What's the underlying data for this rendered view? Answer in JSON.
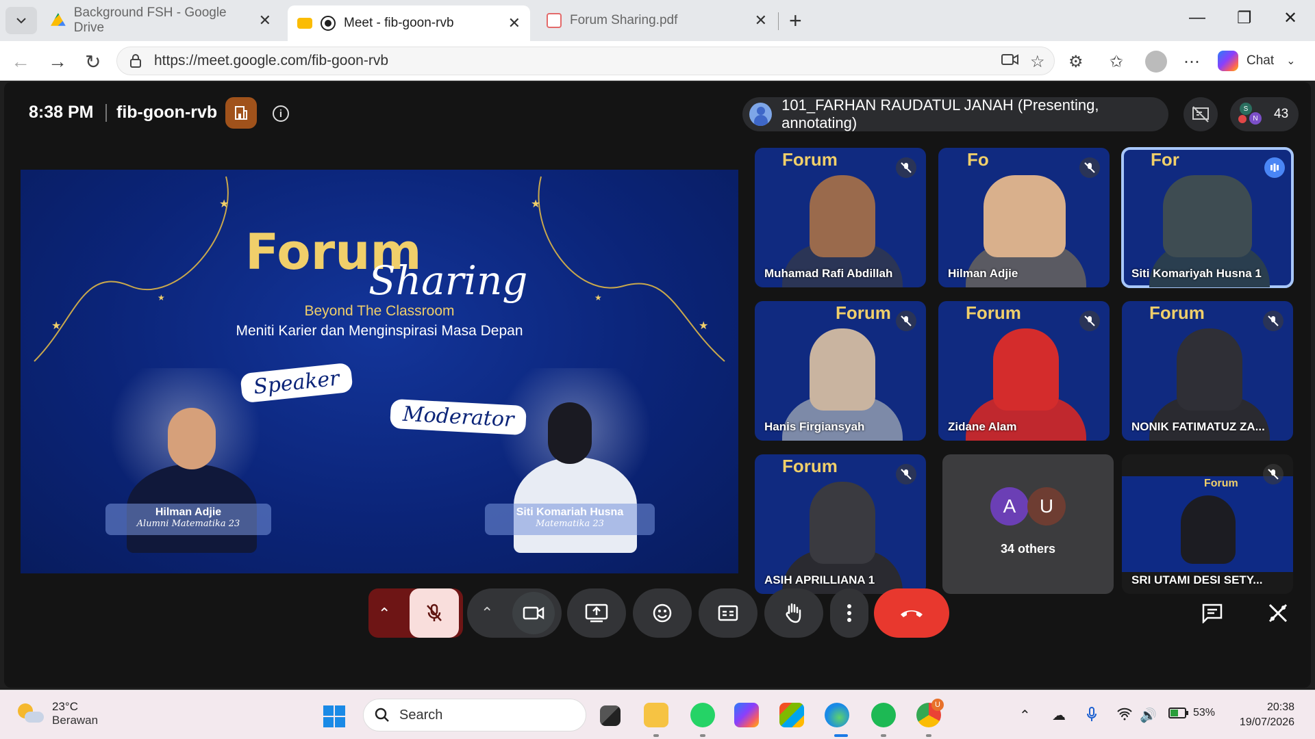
{
  "browser": {
    "tabs": [
      {
        "title": "Background FSH - Google Drive"
      },
      {
        "title": "Meet - fib-goon-rvb"
      },
      {
        "title": "Forum Sharing.pdf"
      }
    ],
    "url": "https://meet.google.com/fib-goon-rvb",
    "chat_label": "Chat"
  },
  "meet": {
    "time": "8:38 PM",
    "code": "fib-goon-rvb",
    "presenter": "101_FARHAN RAUDATUL JANAH (Presenting, annotating)",
    "participant_count": "43",
    "people_avatars": [
      "S",
      "N"
    ],
    "slide": {
      "title_word1": "Forum",
      "title_word2": "Sharing",
      "subtitle": "Beyond The Classroom",
      "tagline": "Meniti Karier dan Menginspirasi Masa Depan",
      "speaker_tag": "Speaker",
      "moderator_tag": "Moderator",
      "speaker_name": "Hilman Adjie",
      "speaker_desc": "Alumni Matematika 23",
      "moderator_name": "Siti Komariah Husna",
      "moderator_desc": "Matematika 23"
    },
    "tiles": [
      {
        "name": "Muhamad Rafi Abdillah",
        "bg": "Forum",
        "status": "muted"
      },
      {
        "name": "Hilman Adjie",
        "bg": "Fo",
        "status": "muted"
      },
      {
        "name": "Siti Komariyah Husna 1",
        "bg": "For",
        "status": "speaking"
      },
      {
        "name": "Hanis Firgiansyah",
        "bg": "Forum",
        "status": "muted"
      },
      {
        "name": "Zidane Alam",
        "bg": "Forum",
        "status": "muted"
      },
      {
        "name": "NONIK FATIMATUZ ZA...",
        "bg": "Forum",
        "status": "muted"
      },
      {
        "name": "ASIH APRILLIANA 1",
        "bg": "Forum",
        "status": "muted"
      },
      {
        "name": "SRI UTAMI DESI SETY...",
        "bg": "Forum",
        "status": "muted"
      }
    ],
    "others": {
      "avatars": [
        "A",
        "U"
      ],
      "label": "34 others"
    }
  },
  "taskbar": {
    "temperature": "23°C",
    "weather": "Berawan",
    "search_placeholder": "Search",
    "battery": "53%",
    "time": "20:38",
    "date": "19/07/2026",
    "chrome_badge": "U"
  }
}
